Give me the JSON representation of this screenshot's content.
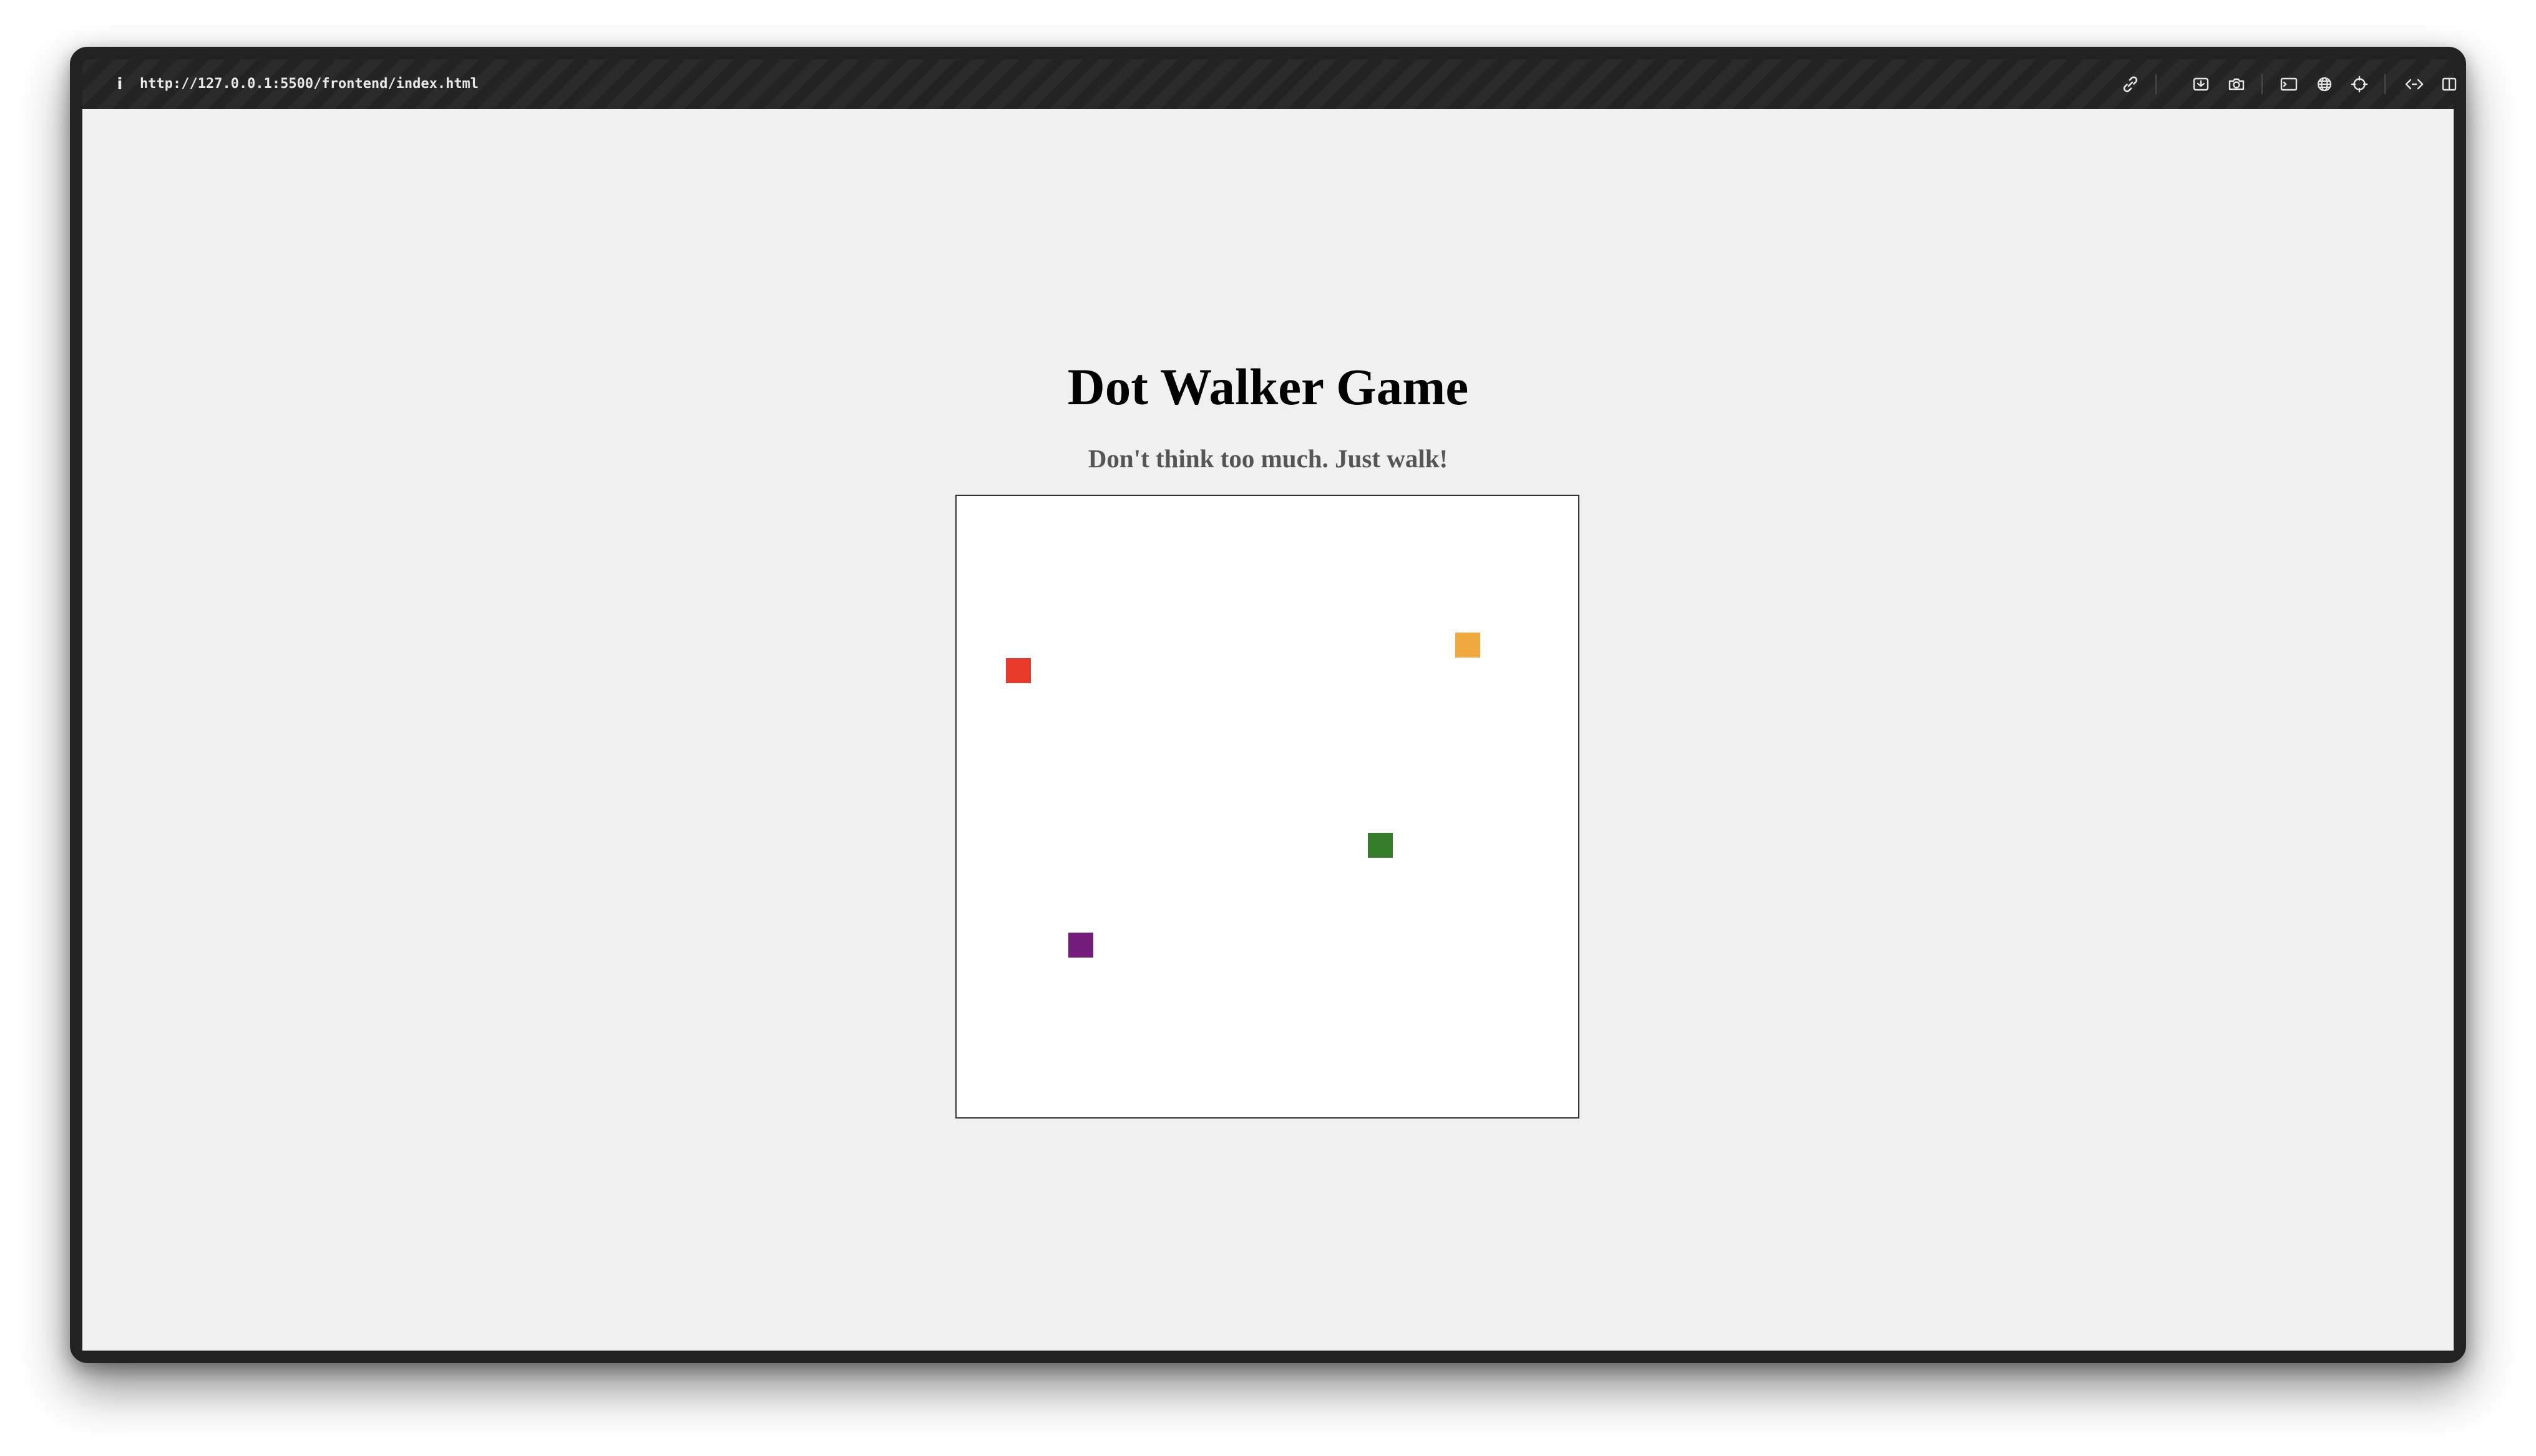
{
  "browser": {
    "info_icon": "info-icon",
    "info_glyph": "i",
    "url": "http://127.0.0.1:5500/frontend/index.html",
    "toolbar_icons": [
      "link-icon",
      "screenshot-icon",
      "camera-icon",
      "terminal-icon",
      "globe-icon",
      "crosshair-icon",
      "code-icon",
      "split-view-icon"
    ]
  },
  "page": {
    "title": "Dot Walker Game",
    "subtitle": "Don't think too much. Just walk!",
    "background": "#f0f0f0"
  },
  "game": {
    "board_background": "#ffffff",
    "dots": [
      {
        "name": "dot-red",
        "color": "#e8392b"
      },
      {
        "name": "dot-orange",
        "color": "#f0a93e"
      },
      {
        "name": "dot-green",
        "color": "#367d2b"
      },
      {
        "name": "dot-purple",
        "color": "#741c7c"
      }
    ]
  }
}
